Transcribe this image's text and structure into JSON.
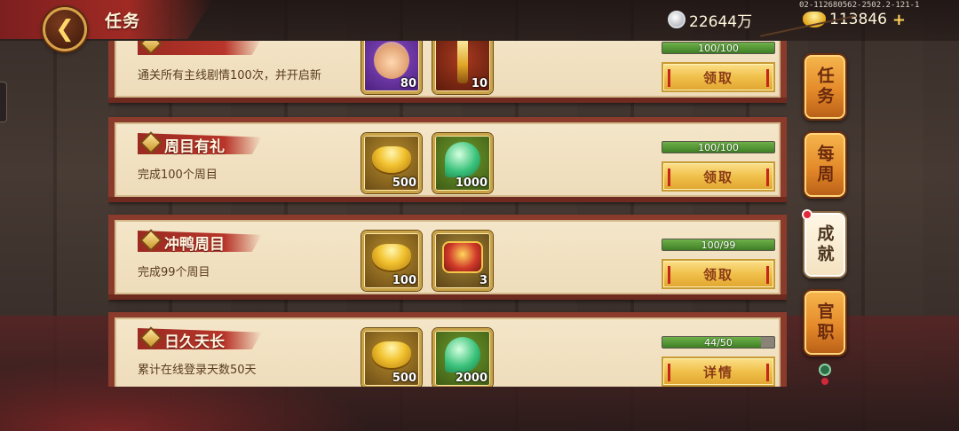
{
  "header": {
    "title": "任务",
    "back_icon": "back-arrow-icon",
    "version": "02-112680562-2502.2-121-1",
    "currencies": [
      {
        "icon": "silver-coin-icon",
        "amount": "22644万"
      },
      {
        "icon": "gold-ingot-icon",
        "amount": "113846"
      }
    ],
    "plus_label": "+"
  },
  "tasks": [
    {
      "title": "",
      "desc": "通关所有主线剧情100次，并开启新",
      "rewards": [
        {
          "icon": "hero-portrait-icon",
          "qty": "80"
        },
        {
          "icon": "golden-weapon-icon",
          "qty": "10"
        }
      ],
      "progress_text": "100/100",
      "progress": 1.0,
      "button_label": "领取"
    },
    {
      "title": "周目有礼",
      "desc": "完成100个周目",
      "rewards": [
        {
          "icon": "gold-ingot-icon",
          "qty": "500"
        },
        {
          "icon": "jade-icon",
          "qty": "1000"
        }
      ],
      "progress_text": "100/100",
      "progress": 1.0,
      "button_label": "领取"
    },
    {
      "title": "冲鸭周目",
      "desc": "完成99个周目",
      "rewards": [
        {
          "icon": "gold-ingot-icon",
          "qty": "100"
        },
        {
          "icon": "treasure-chest-icon",
          "qty": "3"
        }
      ],
      "progress_text": "100/99",
      "progress": 1.0,
      "button_label": "领取"
    },
    {
      "title": "日久天长",
      "desc": "累计在线登录天数50天",
      "rewards": [
        {
          "icon": "gold-ingot-icon",
          "qty": "500"
        },
        {
          "icon": "jade-icon",
          "qty": "2000"
        }
      ],
      "progress_text": "44/50",
      "progress": 0.88,
      "button_label": "详情"
    }
  ],
  "side_tabs": [
    {
      "label": "任务",
      "active": false
    },
    {
      "label": "每周",
      "active": false
    },
    {
      "label": "成就",
      "active": true
    },
    {
      "label": "官职",
      "active": false
    }
  ],
  "colors": {
    "card_bg": "#f4e6c9",
    "card_border": "#8b3b2c",
    "progress_green": "#4f9a30",
    "button_gold": "#f0c04a",
    "tab_orange": "#e48a2a"
  }
}
